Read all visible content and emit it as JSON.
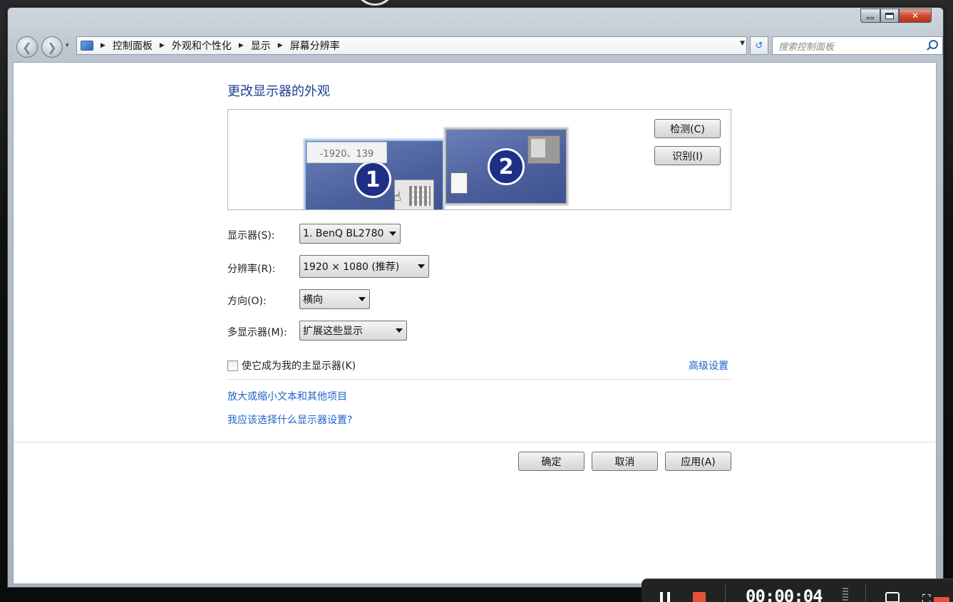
{
  "window": {
    "minimize_label": "",
    "close_label": "✕"
  },
  "navbar": {
    "back_glyph": "❮",
    "forward_glyph": "❯",
    "breadcrumbs": [
      "控制面板",
      "外观和个性化",
      "显示",
      "屏幕分辨率"
    ],
    "search_placeholder": "搜索控制面板"
  },
  "main": {
    "heading": "更改显示器的外观",
    "tooltip": "-1920、139",
    "monitor1_number": "1",
    "monitor2_number": "2",
    "detect_button": "检测(C)",
    "identify_button": "识别(I)"
  },
  "settings": {
    "display_label": "显示器(S):",
    "display_value": "1. BenQ BL2780",
    "resolution_label": "分辨率(R):",
    "resolution_value": "1920 × 1080 (推荐)",
    "orientation_label": "方向(O):",
    "orientation_value": "横向",
    "multi_label": "多显示器(M):",
    "multi_value": "扩展这些显示",
    "primary_checkbox_label": "使它成为我的主显示器(K)",
    "primary_checked": false,
    "advanced_link": "高级设置"
  },
  "links": {
    "zoom_text": "放大或缩小文本和其他项目",
    "help_text": "我应该选择什么显示器设置?"
  },
  "footer": {
    "ok": "确定",
    "cancel": "取消",
    "apply": "应用(A)"
  },
  "recorder": {
    "time": "00:00:04"
  },
  "colors": {
    "heading": "#1e3f91",
    "link": "#1e64c8",
    "monitor_blue": "#4a5f9c"
  }
}
